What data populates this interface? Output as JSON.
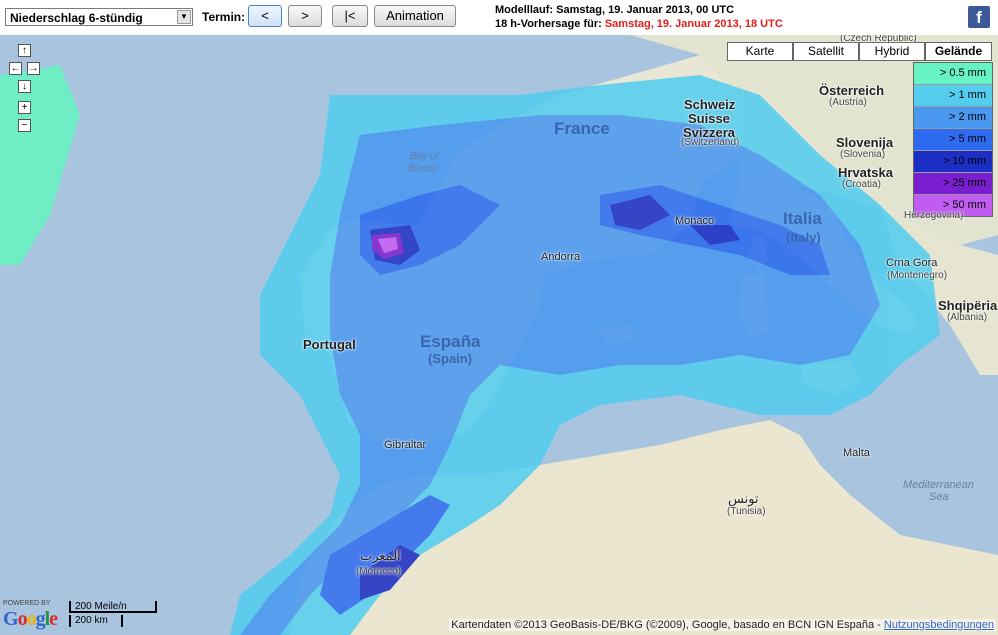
{
  "toolbar": {
    "product_select": "Niederschlag 6-stündig",
    "termin_label": "Termin:",
    "prev_label": "<",
    "next_label": ">",
    "first_label": "|<",
    "animation_label": "Animation"
  },
  "model": {
    "run_label": "Modelllauf:",
    "run_value": "Samstag, 19. Januar 2013, 00 UTC",
    "forecast_label": "18 h-Vorhersage für:",
    "forecast_value": "Samstag, 19. Januar 2013, 18 UTC"
  },
  "social": {
    "facebook_glyph": "f"
  },
  "map_types": [
    "Karte",
    "Satellit",
    "Hybrid",
    "Gelände"
  ],
  "selected_map_type": "Gelände",
  "legend": [
    {
      "label": "> 0.5 mm",
      "color": "#66f2c2"
    },
    {
      "label": "> 1 mm",
      "color": "#55cdee"
    },
    {
      "label": "> 2 mm",
      "color": "#4a98f0"
    },
    {
      "label": "> 5 mm",
      "color": "#2d6cf0"
    },
    {
      "label": "> 10 mm",
      "color": "#1c2fc4"
    },
    {
      "label": "> 25 mm",
      "color": "#7a1fcf"
    },
    {
      "label": "> 50 mm",
      "color": "#c15cf2"
    }
  ],
  "nav": {
    "up": "↑",
    "left": "←",
    "right": "→",
    "down": "↓",
    "zoom_in": "+",
    "zoom_out": "−"
  },
  "places": {
    "czech": "(Czech Republic)",
    "oesterreich": "Österreich",
    "austria": "(Austria)",
    "schweiz": "Schweiz",
    "suisse": "Suisse",
    "svizzera": "Svizzera",
    "switzerland": "(Switzerland)",
    "slovenija": "Slovenija",
    "slovenia": "(Slovenia)",
    "hrvatska": "Hrvatska",
    "croatia": "(Croatia)",
    "herzegovina": "Herzegovina)",
    "france": "France",
    "bay_of_biscay_1": "Bay of",
    "bay_of_biscay_2": "Biscay",
    "monaco": "Monaco",
    "italia": "Italia",
    "italy": "(Italy)",
    "andorra": "Andorra",
    "crna_gora": "Crna Gora",
    "montenegro": "(Montenegro)",
    "shqiperia": "Shqipëria",
    "albania": "(Albania)",
    "portugal": "Portugal",
    "espana": "España",
    "spain": "(Spain)",
    "gibraltar": "Gibraltar",
    "malta": "Malta",
    "tunis_ar": "تونس",
    "tunisia": "(Tunisia)",
    "med_sea_1": "Mediterranean",
    "med_sea_2": "Sea",
    "morocco_ar": "المغرب",
    "morocco": "(Morocco)"
  },
  "branding": {
    "powered_by": "POWERED BY",
    "google": "Google"
  },
  "scale": {
    "miles": "200 Meile/n",
    "km": "200 km"
  },
  "attribution": {
    "text": "Kartendaten ©2013 GeoBasis-DE/BKG (©2009), Google, basado en BCN IGN España -",
    "terms_link": "Nutzungsbedingungen"
  }
}
